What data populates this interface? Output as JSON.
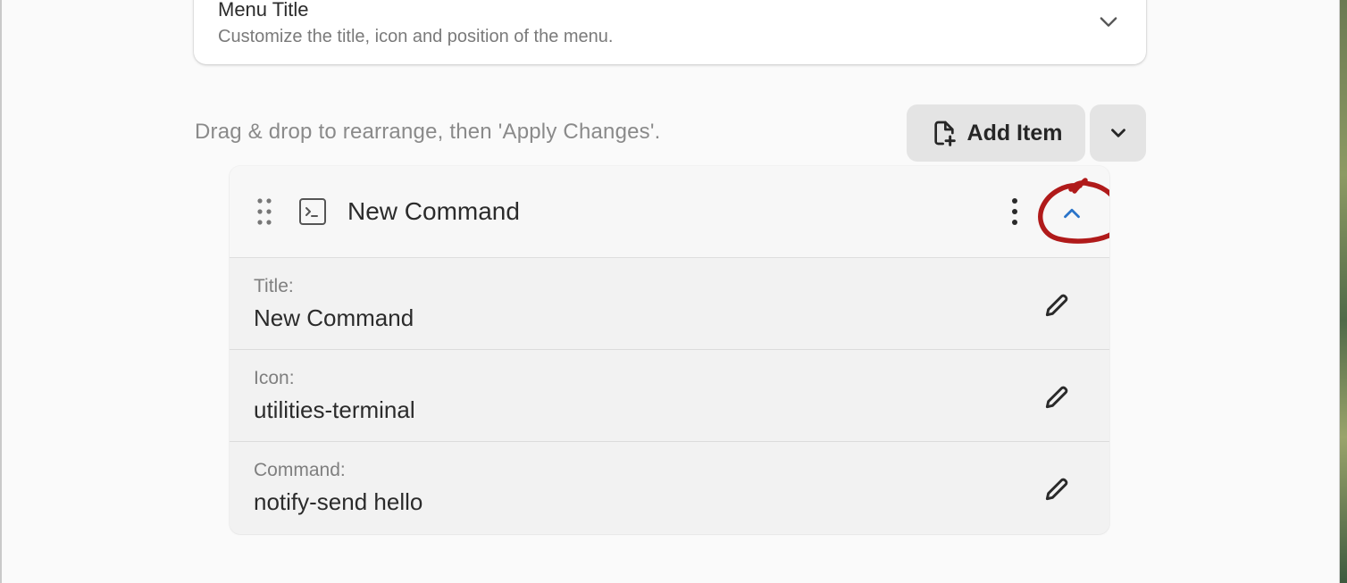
{
  "menu_title_section": {
    "title": "Menu Title",
    "subtitle": "Customize the title, icon and position of the menu."
  },
  "toolbar": {
    "instructions": "Drag & drop to rearrange, then 'Apply Changes'.",
    "add_item_label": "Add Item"
  },
  "item": {
    "title": "New Command",
    "icon": "utilities-terminal",
    "fields": [
      {
        "label": "Title:",
        "value": "New Command"
      },
      {
        "label": "Icon:",
        "value": "utilities-terminal"
      },
      {
        "label": "Command:",
        "value": "notify-send hello"
      }
    ]
  },
  "colors": {
    "accent": "#2a74c9",
    "annotation": "#b01a1a",
    "button_bg": "#e4e4e4"
  }
}
